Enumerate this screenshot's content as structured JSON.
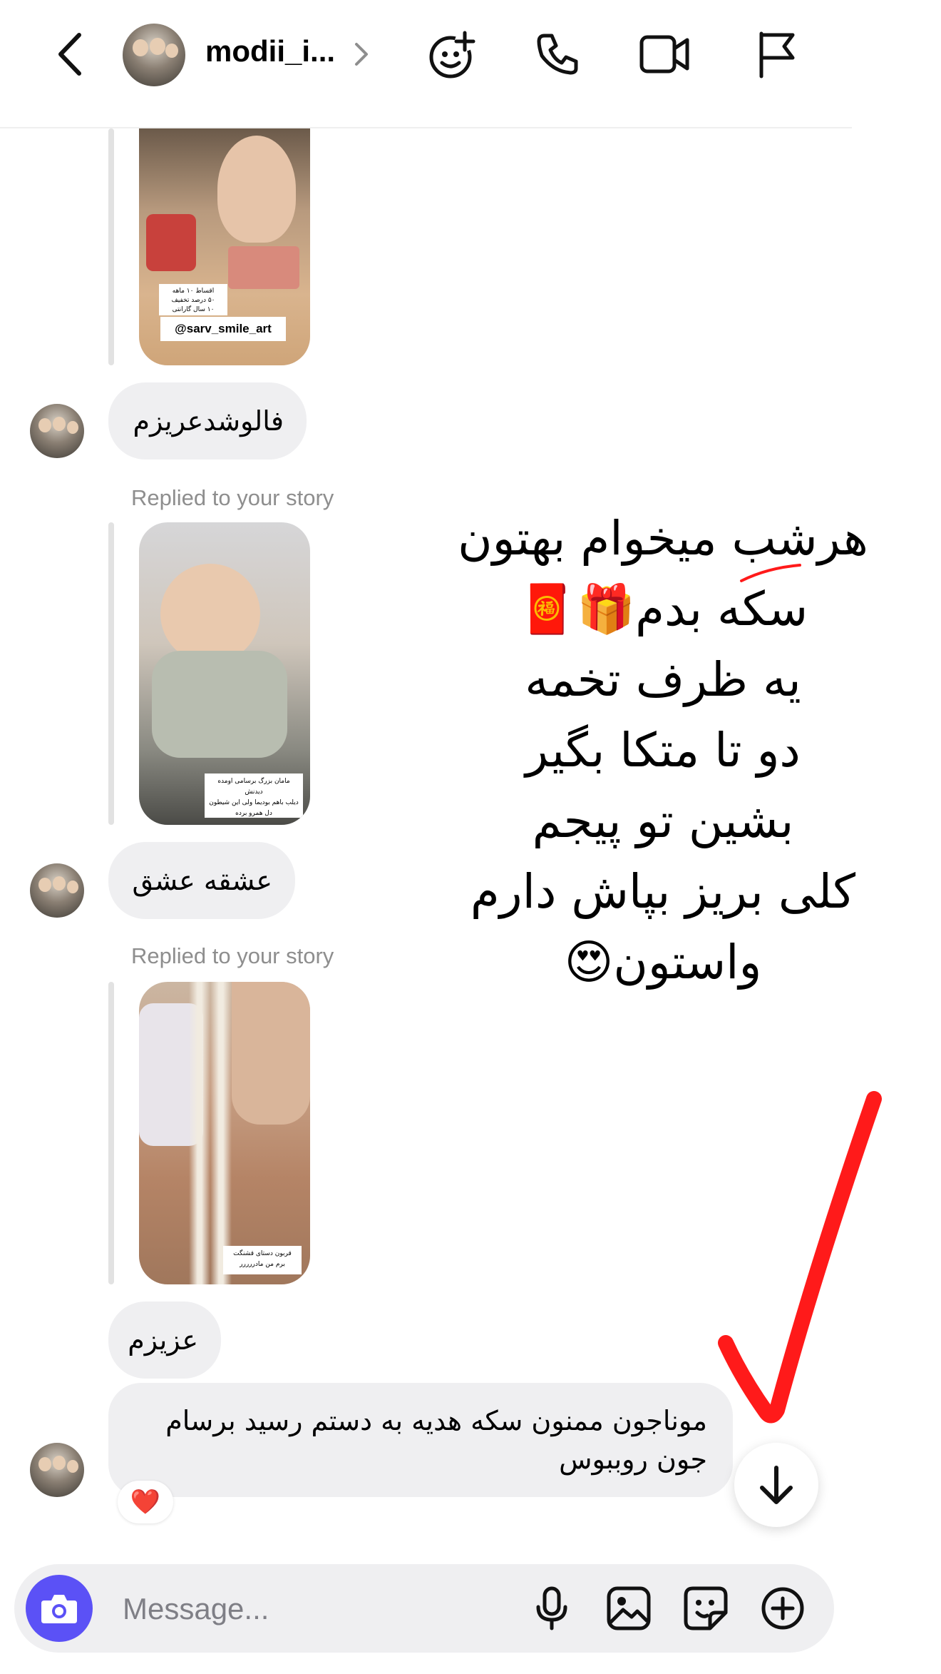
{
  "header": {
    "username": "modii_i...",
    "icons": [
      "back-arrow",
      "avatar",
      "chevron-right",
      "effects-face",
      "phone",
      "video-camera",
      "flag"
    ]
  },
  "thread": {
    "story1": {
      "caption_lines": [
        "اقساط ۱۰ ماهه",
        "۵۰ درصد تخفیف",
        "۱۰ سال گارانتی",
        "@sarv_smile_art"
      ]
    },
    "msg1": "فالوشدعریزم",
    "replied2": "Replied to your story",
    "story2": {
      "caption_lines": [
        "مامان بزرگ برسامی اومده دیدنش",
        "دیلب باهم بودیما ولی این شیطون",
        "دل همرو برده"
      ]
    },
    "msg2": "عشقه عشق",
    "replied3": "Replied to your story",
    "story3": {
      "caption_lines": [
        "قربون دستای قشنگت",
        "برم من مادررررر"
      ]
    },
    "msg3": "عزیزم",
    "msg4": "موناجون ممنون سکه هدیه به دستم رسید برسام جون روببوس",
    "msg4_reaction": "❤️"
  },
  "overlay": {
    "lines": [
      "هرشب میخوام بهتون",
      "سکه بدم🎁🧧",
      "یه ظرف تخمه",
      "دو تا متکا بگیر",
      "بشین تو پیجم",
      "کلی بریز بپاش دارم",
      "واستون😍"
    ],
    "checkmark_color": "#ff1a1a"
  },
  "composer": {
    "placeholder": "Message...",
    "icons": [
      "camera",
      "microphone",
      "gallery",
      "sticker",
      "plus-circle"
    ],
    "camera_color": "#5b51f6"
  }
}
